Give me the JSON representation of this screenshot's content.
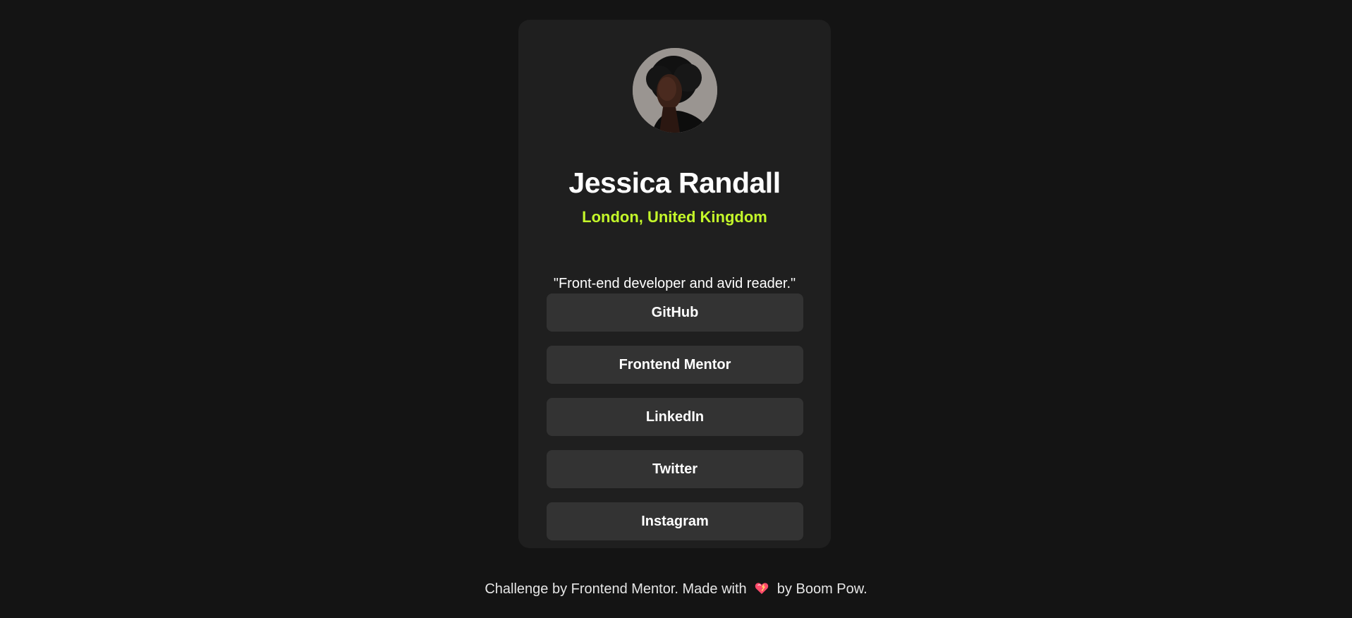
{
  "profile": {
    "name": "Jessica Randall",
    "location": "London, United Kingdom",
    "bio": "\"Front-end developer and avid reader.\"",
    "avatar_icon": "profile-photo"
  },
  "links": [
    {
      "label": "GitHub"
    },
    {
      "label": "Frontend Mentor"
    },
    {
      "label": "LinkedIn"
    },
    {
      "label": "Twitter"
    },
    {
      "label": "Instagram"
    }
  ],
  "footer": {
    "prefix": "Challenge by Frontend Mentor. Made with",
    "heart_icon": "heart-icon",
    "suffix": "by Boom Pow."
  },
  "colors": {
    "background": "#141414",
    "card": "#1f1f1f",
    "button": "#333333",
    "accent": "#c4f82a",
    "text": "#ffffff"
  }
}
